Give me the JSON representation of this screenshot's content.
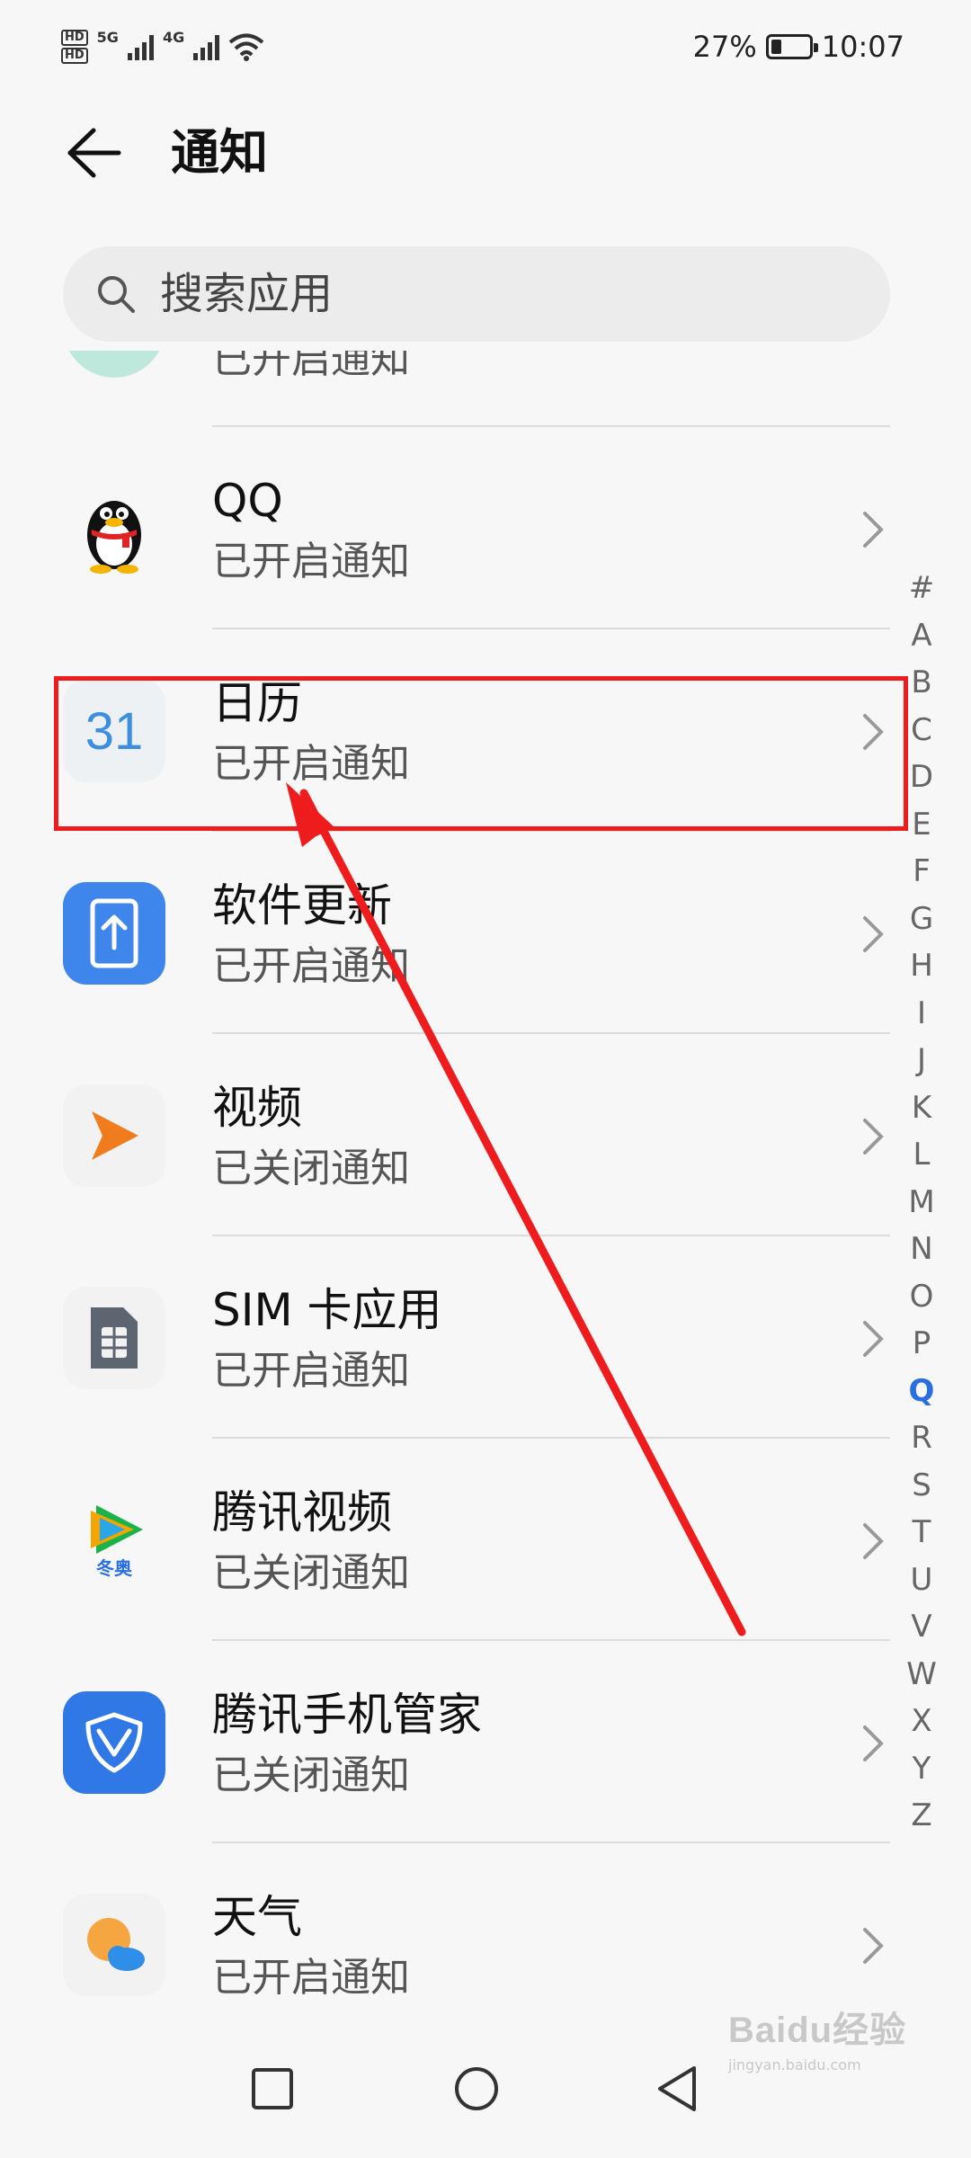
{
  "status_bar": {
    "network_1": "5G",
    "network_2": "4G",
    "hd_badge": "HD",
    "battery_percent": "27%",
    "battery_level": 0.27,
    "time": "10:07"
  },
  "header": {
    "title": "通知"
  },
  "search": {
    "placeholder": "搜索应用"
  },
  "apps": [
    {
      "name": "",
      "status": "已开启通知",
      "icon": "partial-teal-icon"
    },
    {
      "name": "QQ",
      "status": "已开启通知",
      "icon": "qq-penguin-icon"
    },
    {
      "name": "日历",
      "status": "已开启通知",
      "icon": "calendar-icon",
      "icon_text": "31"
    },
    {
      "name": "软件更新",
      "status": "已开启通知",
      "icon": "software-update-icon"
    },
    {
      "name": "视频",
      "status": "已关闭通知",
      "icon": "video-play-icon"
    },
    {
      "name": "SIM 卡应用",
      "status": "已开启通知",
      "icon": "sim-card-icon"
    },
    {
      "name": "腾讯视频",
      "status": "已关闭通知",
      "icon": "tencent-video-icon",
      "icon_text": "冬奥"
    },
    {
      "name": "腾讯手机管家",
      "status": "已关闭通知",
      "icon": "tencent-security-icon"
    },
    {
      "name": "天气",
      "status": "已开启通知",
      "icon": "weather-icon"
    }
  ],
  "alphabet_index": [
    "#",
    "A",
    "B",
    "C",
    "D",
    "E",
    "F",
    "G",
    "H",
    "I",
    "J",
    "K",
    "L",
    "M",
    "N",
    "O",
    "P",
    "Q",
    "R",
    "S",
    "T",
    "U",
    "V",
    "W",
    "X",
    "Y",
    "Z"
  ],
  "alphabet_active": "Q",
  "watermark": {
    "logo": "Baidu经验",
    "url": "jingyan.baidu.com"
  },
  "colors": {
    "accent": "#2a6fe0",
    "annotation": "#ee1c1c",
    "background": "#f7f7f7"
  }
}
